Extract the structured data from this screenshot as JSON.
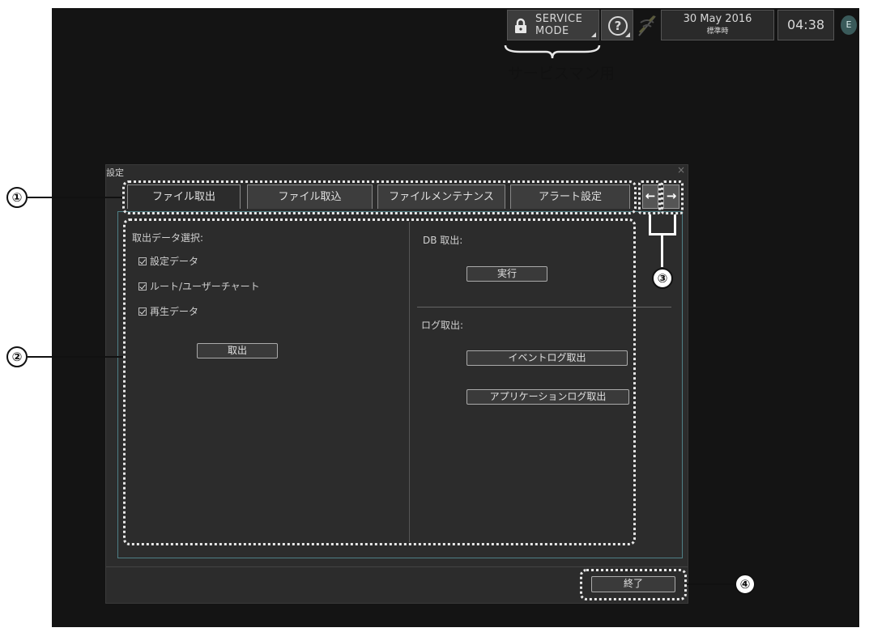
{
  "status_bar": {
    "service_mode_line1": "SERVICE",
    "service_mode_line2": "MODE",
    "help_icon": "question-circle-icon",
    "network_icon": "network-icon",
    "date": "30 May 2016",
    "date_sub": "標準時",
    "time": "04:38",
    "badge": "E"
  },
  "service_annotation": "サービスマン用",
  "dialog": {
    "title": "設定",
    "close": "×",
    "tabs": [
      {
        "label": "ファイル取出",
        "active": true
      },
      {
        "label": "ファイル取込",
        "active": false
      },
      {
        "label": "ファイルメンテナンス",
        "active": false
      },
      {
        "label": "アラート設定",
        "active": false
      }
    ],
    "prev_arrow": "←",
    "next_arrow": "→",
    "left": {
      "heading": "取出データ選択:",
      "checkboxes": [
        {
          "label": "設定データ",
          "checked": true
        },
        {
          "label": "ルート/ユーザーチャート",
          "checked": true
        },
        {
          "label": "再生データ",
          "checked": true
        }
      ],
      "export_button": "取出"
    },
    "right": {
      "db_heading": "DB 取出:",
      "execute_button": "実行",
      "log_heading": "ログ取出:",
      "event_log_button": "イベントログ取出",
      "app_log_button": "アプリケーションログ取出"
    },
    "exit_button": "終了"
  },
  "callouts": [
    "①",
    "②",
    "③",
    "④"
  ],
  "colors": {
    "background": "#141414",
    "dialog": "#2c2c2c",
    "panel_border": "#4e7f86",
    "text": "#cfcfcf"
  }
}
